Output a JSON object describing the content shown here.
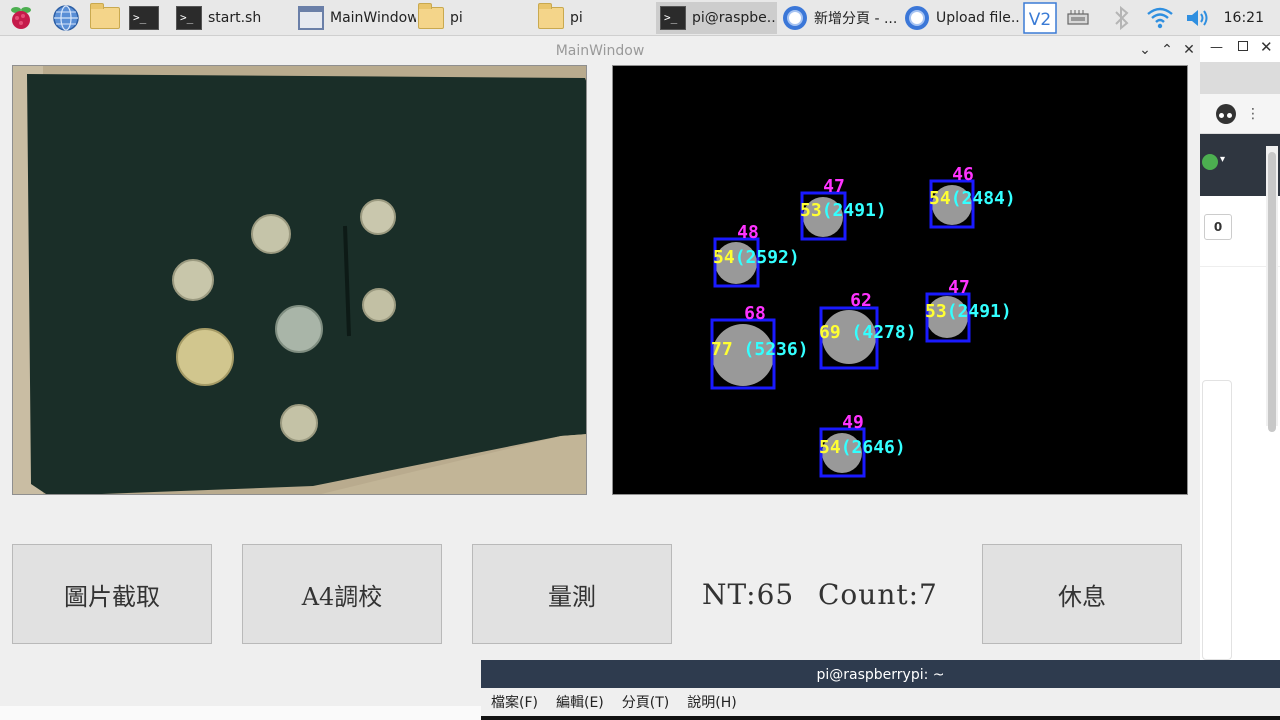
{
  "taskbar": {
    "tasks": [
      {
        "label": "start.sh"
      },
      {
        "label": "MainWindow"
      },
      {
        "label": "pi"
      },
      {
        "label": "pi"
      },
      {
        "label": "pi@raspbe..."
      },
      {
        "label": "新增分頁 - ..."
      },
      {
        "label": "Upload file..."
      }
    ],
    "clock": "16:21"
  },
  "window": {
    "title": "MainWindow",
    "buttons": {
      "capture": "圖片截取",
      "calibrate": "A4調校",
      "measure": "量測",
      "rest": "休息"
    },
    "readout": {
      "nt": "NT:65",
      "count": "Count:7"
    }
  },
  "detections": [
    {
      "diameter": "48",
      "label": "54(2592)"
    },
    {
      "diameter": "47",
      "label": "53(2491)"
    },
    {
      "diameter": "46",
      "label": "54(2484)"
    },
    {
      "diameter": "68",
      "label": "77 (5236)"
    },
    {
      "diameter": "62",
      "label": "69 (4278)"
    },
    {
      "diameter": "47",
      "label": "53(2491)"
    },
    {
      "diameter": "49",
      "label": "54(2646)"
    }
  ],
  "browser": {
    "badge": "0"
  },
  "terminal": {
    "title": "pi@raspberrypi: ~",
    "menu": [
      "檔案(F)",
      "編輯(E)",
      "分頁(T)",
      "說明(H)"
    ]
  },
  "colors": {
    "accent": "#2e3b4e",
    "box": "#1a1aff",
    "diameter": "#ff33ff",
    "label_value": "#ffff33",
    "label_area": "#33ffff"
  }
}
